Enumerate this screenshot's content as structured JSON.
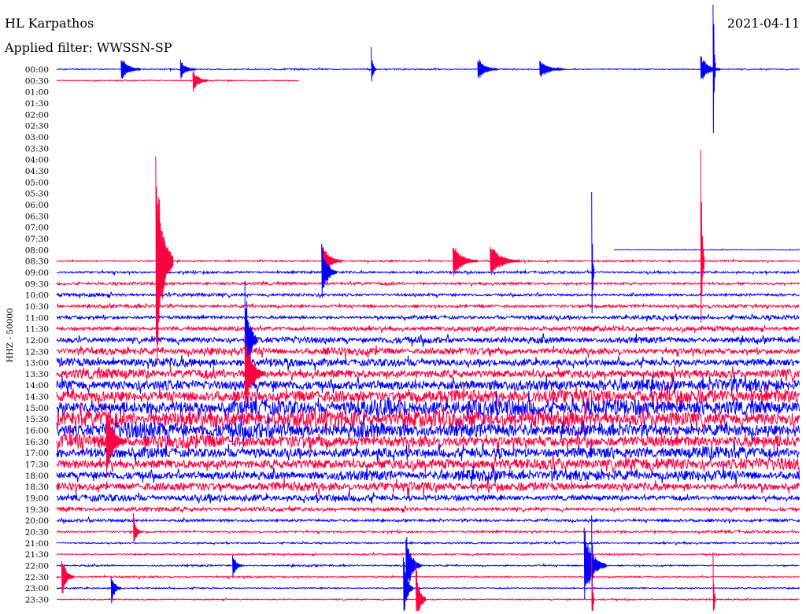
{
  "header": {
    "station": "HL Karpathos",
    "date": "2021-04-11",
    "filter": "Applied filter: WWSSN-SP"
  },
  "chart_data": {
    "type": "line",
    "title": "HL Karpathos",
    "date": "2021-04-11",
    "subtitle": "Applied filter: WWSSN-SP",
    "ylabel": "HHZ - 50000",
    "xlabel": "",
    "grid": false,
    "x_unit": "minutes",
    "x_range": [
      0,
      30
    ],
    "row_labels": [
      "00:00",
      "00:30",
      "01:00",
      "01:30",
      "02:00",
      "02:30",
      "03:00",
      "03:30",
      "04:00",
      "04:30",
      "05:00",
      "05:30",
      "06:00",
      "06:30",
      "07:00",
      "07:30",
      "08:00",
      "08:30",
      "09:00",
      "09:30",
      "10:00",
      "10:30",
      "11:00",
      "11:30",
      "12:00",
      "12:30",
      "13:00",
      "13:30",
      "14:00",
      "14:30",
      "15:00",
      "15:30",
      "16:00",
      "16:30",
      "17:00",
      "17:30",
      "18:00",
      "18:30",
      "19:00",
      "19:30",
      "20:00",
      "20:30",
      "21:00",
      "21:30",
      "22:00",
      "22:30",
      "23:00",
      "23:30"
    ],
    "colors": {
      "even_rows": "#0000ff",
      "odd_rows": "#ff0040"
    },
    "series": [
      {
        "row": "00:00",
        "amp": 0.18,
        "start": 0,
        "end": 30
      },
      {
        "row": "00:30",
        "amp": 0.14,
        "start": 0,
        "end": 9.8
      },
      {
        "row": "08:00",
        "amp": 0.1,
        "start": 22.5,
        "end": 30
      },
      {
        "row": "08:30",
        "amp": 0.22,
        "start": 0,
        "end": 30
      },
      {
        "row": "09:00",
        "amp": 0.3,
        "start": 0,
        "end": 30
      },
      {
        "row": "09:30",
        "amp": 0.35,
        "start": 0,
        "end": 30
      },
      {
        "row": "10:00",
        "amp": 0.4,
        "start": 0,
        "end": 30
      },
      {
        "row": "10:30",
        "amp": 0.45,
        "start": 0,
        "end": 30
      },
      {
        "row": "11:00",
        "amp": 0.5,
        "start": 0,
        "end": 30
      },
      {
        "row": "11:30",
        "amp": 0.6,
        "start": 0,
        "end": 30
      },
      {
        "row": "12:00",
        "amp": 0.8,
        "start": 0,
        "end": 30
      },
      {
        "row": "12:30",
        "amp": 0.9,
        "start": 0,
        "end": 30
      },
      {
        "row": "13:00",
        "amp": 1.1,
        "start": 0,
        "end": 30
      },
      {
        "row": "13:30",
        "amp": 1.3,
        "start": 0,
        "end": 30
      },
      {
        "row": "14:00",
        "amp": 1.6,
        "start": 0,
        "end": 30
      },
      {
        "row": "14:30",
        "amp": 1.8,
        "start": 0,
        "end": 30
      },
      {
        "row": "15:00",
        "amp": 2.0,
        "start": 0,
        "end": 30
      },
      {
        "row": "15:30",
        "amp": 2.2,
        "start": 0,
        "end": 30
      },
      {
        "row": "16:00",
        "amp": 2.0,
        "start": 0,
        "end": 30
      },
      {
        "row": "16:30",
        "amp": 1.8,
        "start": 0,
        "end": 30
      },
      {
        "row": "17:00",
        "amp": 1.6,
        "start": 0,
        "end": 30
      },
      {
        "row": "17:30",
        "amp": 1.5,
        "start": 0,
        "end": 30
      },
      {
        "row": "18:00",
        "amp": 1.3,
        "start": 0,
        "end": 30
      },
      {
        "row": "18:30",
        "amp": 1.1,
        "start": 0,
        "end": 30
      },
      {
        "row": "19:00",
        "amp": 0.8,
        "start": 0,
        "end": 30
      },
      {
        "row": "19:30",
        "amp": 0.55,
        "start": 0,
        "end": 30
      },
      {
        "row": "20:00",
        "amp": 0.4,
        "start": 0,
        "end": 30
      },
      {
        "row": "20:30",
        "amp": 0.3,
        "start": 0,
        "end": 30
      },
      {
        "row": "21:00",
        "amp": 0.22,
        "start": 0,
        "end": 30
      },
      {
        "row": "21:30",
        "amp": 0.2,
        "start": 0,
        "end": 30
      },
      {
        "row": "22:00",
        "amp": 0.2,
        "start": 0,
        "end": 30
      },
      {
        "row": "22:30",
        "amp": 0.2,
        "start": 0,
        "end": 30
      },
      {
        "row": "23:00",
        "amp": 0.18,
        "start": 0,
        "end": 30
      },
      {
        "row": "23:30",
        "amp": 0.18,
        "start": 0,
        "end": 30
      }
    ],
    "events": [
      {
        "row": "00:00",
        "minute": 2.6,
        "amp": 0.5,
        "dur": 0.8
      },
      {
        "row": "00:00",
        "minute": 5.0,
        "amp": 0.4,
        "dur": 0.6
      },
      {
        "row": "00:00",
        "minute": 12.7,
        "amp": 0.9,
        "dur": 0.2
      },
      {
        "row": "00:00",
        "minute": 17.0,
        "amp": 0.5,
        "dur": 0.8
      },
      {
        "row": "00:00",
        "minute": 19.5,
        "amp": 0.4,
        "dur": 1.0
      },
      {
        "row": "00:00",
        "minute": 26.0,
        "amp": 0.6,
        "dur": 0.8
      },
      {
        "row": "00:00",
        "minute": 26.5,
        "amp": 6.0,
        "dur": 0.1
      },
      {
        "row": "00:30",
        "minute": 5.5,
        "amp": 0.5,
        "dur": 0.6
      },
      {
        "row": "08:30",
        "minute": 4.0,
        "amp": 5.0,
        "dur": 0.7
      },
      {
        "row": "08:30",
        "minute": 10.7,
        "amp": 0.8,
        "dur": 0.8
      },
      {
        "row": "08:30",
        "minute": 16.0,
        "amp": 0.7,
        "dur": 1.0
      },
      {
        "row": "08:30",
        "minute": 17.5,
        "amp": 0.7,
        "dur": 1.2
      },
      {
        "row": "08:30",
        "minute": 26.0,
        "amp": 5.0,
        "dur": 0.15
      },
      {
        "row": "09:00",
        "minute": 10.7,
        "amp": 1.2,
        "dur": 0.6
      },
      {
        "row": "09:00",
        "minute": 21.6,
        "amp": 3.5,
        "dur": 0.1
      },
      {
        "row": "12:00",
        "minute": 7.6,
        "amp": 2.5,
        "dur": 0.5
      },
      {
        "row": "13:30",
        "minute": 7.6,
        "amp": 1.6,
        "dur": 0.8
      },
      {
        "row": "16:30",
        "minute": 2.0,
        "amp": 1.5,
        "dur": 0.8
      },
      {
        "row": "20:30",
        "minute": 3.1,
        "amp": 0.8,
        "dur": 0.3
      },
      {
        "row": "22:00",
        "minute": 7.1,
        "amp": 0.6,
        "dur": 0.4
      },
      {
        "row": "22:00",
        "minute": 14.1,
        "amp": 1.4,
        "dur": 0.6
      },
      {
        "row": "22:00",
        "minute": 21.3,
        "amp": 1.5,
        "dur": 0.9
      },
      {
        "row": "22:00",
        "minute": 21.6,
        "amp": 3.0,
        "dur": 0.1
      },
      {
        "row": "22:30",
        "minute": 0.2,
        "amp": 0.9,
        "dur": 0.5
      },
      {
        "row": "23:00",
        "minute": 2.2,
        "amp": 0.7,
        "dur": 0.4
      },
      {
        "row": "23:00",
        "minute": 14.0,
        "amp": 1.4,
        "dur": 0.4
      },
      {
        "row": "23:30",
        "minute": 14.5,
        "amp": 1.6,
        "dur": 0.4
      },
      {
        "row": "23:30",
        "minute": 21.6,
        "amp": 2.2,
        "dur": 0.1
      },
      {
        "row": "23:30",
        "minute": 26.5,
        "amp": 2.2,
        "dur": 0.1
      }
    ]
  }
}
